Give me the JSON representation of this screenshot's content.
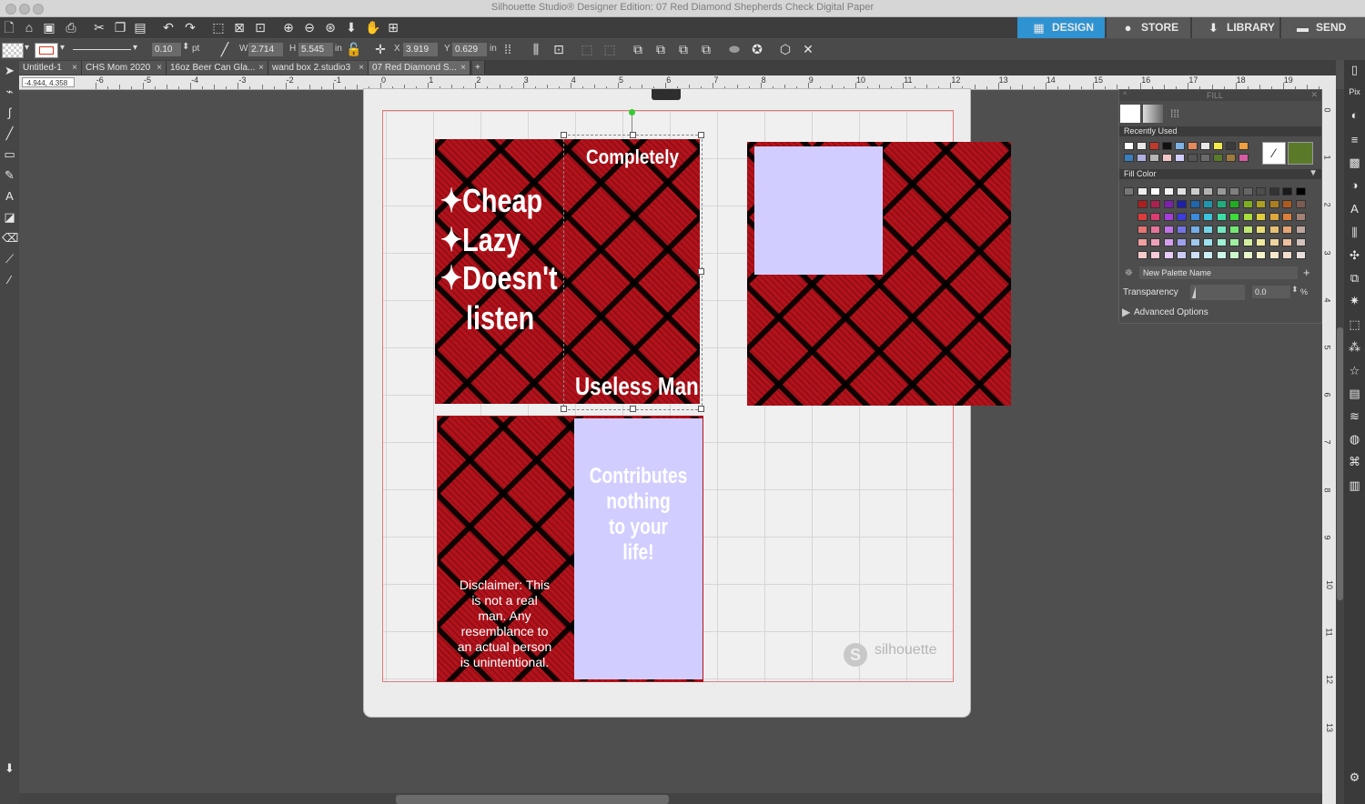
{
  "window": {
    "title": "Silhouette Studio® Designer Edition: 07 Red Diamond Shepherds Check Digital Paper"
  },
  "nav": {
    "design": "DESIGN",
    "store": "STORE",
    "library": "LIBRARY",
    "send": "SEND",
    "accent": "#2f93d1"
  },
  "toolbar": {
    "line_width": "0.10",
    "line_unit": "pt",
    "w_label": "W",
    "w_value": "2.714",
    "h_label": "H",
    "h_value": "5.545",
    "size_unit": "in",
    "x_label": "X",
    "x_value": "3.919",
    "y_label": "Y",
    "y_value": "0.629",
    "pos_unit": "in"
  },
  "tabs": [
    {
      "label": "Untitled-1"
    },
    {
      "label": "CHS Mom 2020"
    },
    {
      "label": "16oz Beer Can Gla..."
    },
    {
      "label": "wand box 2.studio3"
    },
    {
      "label": "07 Red Diamond S..."
    }
  ],
  "tab_close": "×",
  "tab_add": "+",
  "ruler": {
    "coord": "-4.944, 4.358",
    "numbers": [
      "-6",
      "-5",
      "-4",
      "-3",
      "-2",
      "-1",
      "0",
      "1",
      "2",
      "3",
      "4",
      "5",
      "6",
      "7",
      "8",
      "9",
      "10",
      "11",
      "12",
      "13",
      "14",
      "15",
      "16",
      "17",
      "18",
      "19"
    ],
    "v_numbers": [
      "0",
      "1",
      "2",
      "3",
      "4",
      "5",
      "6",
      "7",
      "8",
      "9",
      "10",
      "11",
      "12",
      "13"
    ]
  },
  "card1": {
    "top": "Completely",
    "lines": [
      "✦Cheap",
      "✦Lazy",
      "✦Doesn't",
      "listen"
    ],
    "bottom": "Useless Man"
  },
  "card3": {
    "disclaimer": [
      "Disclaimer: This",
      "is not a real",
      "man. Any",
      "resemblance to",
      "an actual person",
      "is unintentional."
    ],
    "right": [
      "Contributes",
      "nothing",
      "to your",
      "life!"
    ]
  },
  "watermark": "silhouette",
  "fill_panel": {
    "title": "FILL",
    "recently_used": "Recently Used",
    "fill_color": "Fill Color",
    "palette_name": "New Palette Name",
    "transparency_label": "Transparency",
    "transparency_value": "0.0",
    "percent": "%",
    "advanced": "Advanced Options",
    "recent_swatches": [
      "#ffffff",
      "#e8e8e8",
      "#c0392b",
      "#111111",
      "#7fb3e6",
      "#e6895b",
      "#e8e8e8",
      "#f2e94b",
      "#3c3c3c",
      "#f0a03c",
      "#3a7fc0",
      "#b0b0e0",
      "#b5b5b5",
      "#f2c6c6",
      "#d1ceff",
      "#555555",
      "#6a6a6a",
      "#5a7a2a",
      "#a07a3a",
      "#d85aa0"
    ],
    "current_color": "#5a7a2a"
  },
  "colors": {
    "plaid_red": "#b5121b",
    "lavender": "#d1ceff"
  }
}
